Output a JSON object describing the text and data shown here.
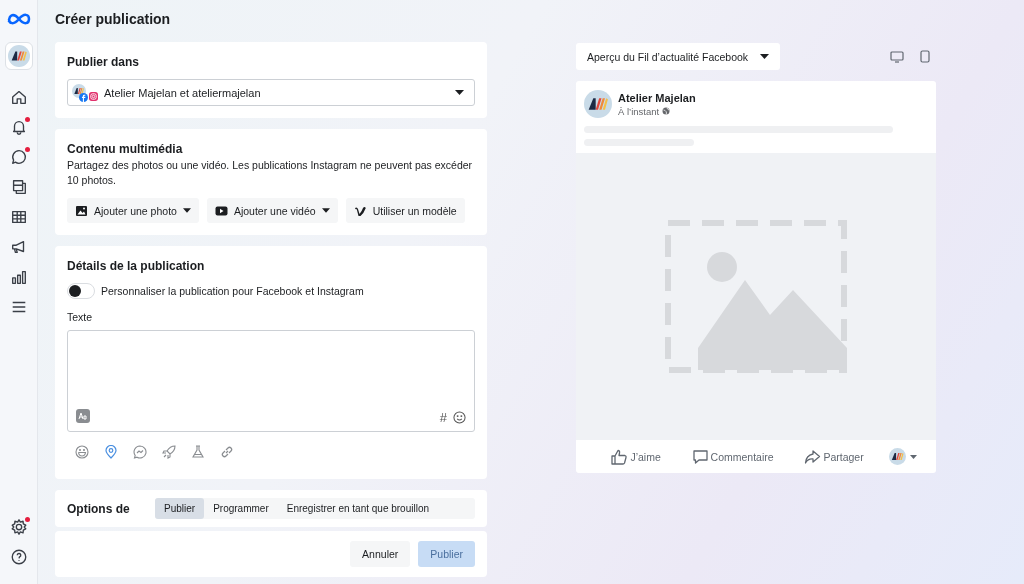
{
  "sidebar": {
    "items": [
      {
        "kind": "home",
        "badge": false
      },
      {
        "kind": "bell",
        "badge": true
      },
      {
        "kind": "chat",
        "badge": true
      },
      {
        "kind": "pages",
        "badge": false
      },
      {
        "kind": "table",
        "badge": false
      },
      {
        "kind": "megaphone",
        "badge": false
      },
      {
        "kind": "chart",
        "badge": false
      },
      {
        "kind": "menu",
        "badge": false
      }
    ],
    "bottom": [
      {
        "kind": "gear",
        "badge": true
      },
      {
        "kind": "help",
        "badge": false
      }
    ]
  },
  "page_title": "Créer publication",
  "publish_in": {
    "title": "Publier dans",
    "account": "Atelier Majelan et ateliermajelan"
  },
  "media": {
    "title": "Contenu multimédia",
    "description": "Partagez des photos ou une vidéo. Les publications Instagram ne peuvent pas excéder 10 photos.",
    "buttons": [
      {
        "kind": "photo",
        "label": "Ajouter une photo",
        "dropdown": true
      },
      {
        "kind": "video",
        "label": "Ajouter une vidéo",
        "dropdown": true
      },
      {
        "kind": "template",
        "label": "Utiliser un modèle",
        "dropdown": false
      }
    ]
  },
  "details": {
    "title": "Détails de la publication",
    "toggle": {
      "label": "Personnaliser la publication pour Facebook et Instagram",
      "on": false
    },
    "text_label": "Texte",
    "hashtag": "#"
  },
  "options": {
    "title": "Options de",
    "tabs": [
      {
        "label": "Publier",
        "selected": true
      },
      {
        "label": "Programmer",
        "selected": false
      },
      {
        "label": "Enregistrer en tant que brouillon",
        "selected": false
      }
    ]
  },
  "footer": {
    "buttons": [
      {
        "label": "Annuler",
        "disabled": false
      },
      {
        "label": "Publier",
        "disabled": true
      }
    ]
  },
  "preview": {
    "selector": "Aperçu du Fil d’actualité Facebook",
    "post": {
      "author": "Atelier Majelan",
      "time": "À l’instant",
      "actions": [
        {
          "kind": "like",
          "label": "J’aime"
        },
        {
          "kind": "comment",
          "label": "Commentaire"
        },
        {
          "kind": "share",
          "label": "Partager"
        }
      ]
    }
  }
}
